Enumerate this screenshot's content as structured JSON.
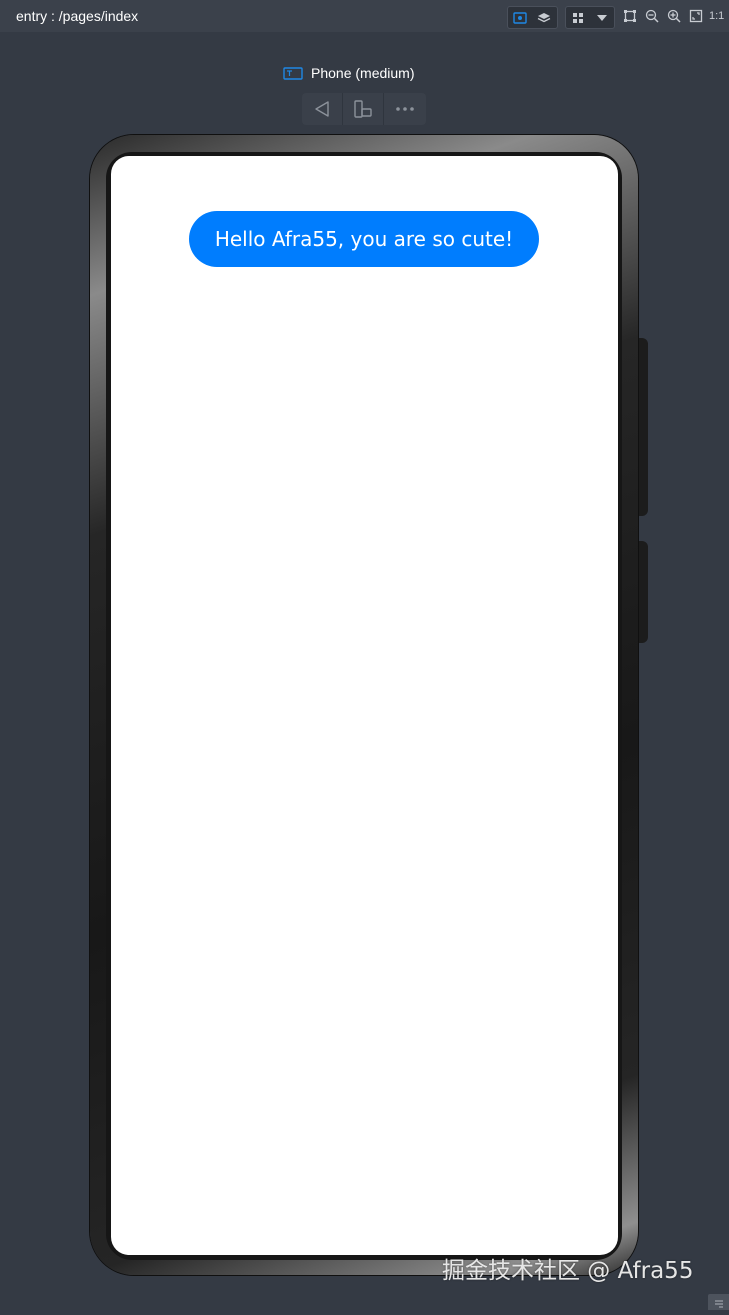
{
  "app": {
    "entry_path": "entry : /pages/index"
  },
  "toolbar": {
    "ratio_label": "1:1",
    "icons": [
      "preview-eye-icon",
      "layers-icon",
      "grid-icon",
      "chevron-down-icon",
      "crop-frame-icon",
      "zoom-out-icon",
      "zoom-in-icon",
      "fit-screen-icon"
    ],
    "accent_color": "#1e88e5"
  },
  "device": {
    "label": "Phone (medium)",
    "toolbar_icons": [
      "back-triangle-icon",
      "rotate-device-icon",
      "more-icon"
    ]
  },
  "screen": {
    "button_label": "Hello Afra55, you are so cute!",
    "button_color": "#007dfe"
  },
  "watermark": {
    "text": "掘金技术社区 @ Afra55"
  }
}
